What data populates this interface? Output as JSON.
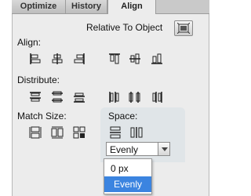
{
  "tabs": [
    {
      "label": "Optimize"
    },
    {
      "label": "History"
    },
    {
      "label": "Align"
    }
  ],
  "relative_to": {
    "label": "Relative To Object"
  },
  "align": {
    "label": "Align:"
  },
  "distribute": {
    "label": "Distribute:"
  },
  "match_size": {
    "label": "Match Size:"
  },
  "space": {
    "label": "Space:",
    "select_value": "Evenly",
    "options": [
      "0 px",
      "Evenly"
    ],
    "selected_option": "Evenly"
  },
  "colors": {
    "panel_bg": "#ececec",
    "space_bg": "#e0e5e8",
    "selection": "#3b84e0"
  }
}
